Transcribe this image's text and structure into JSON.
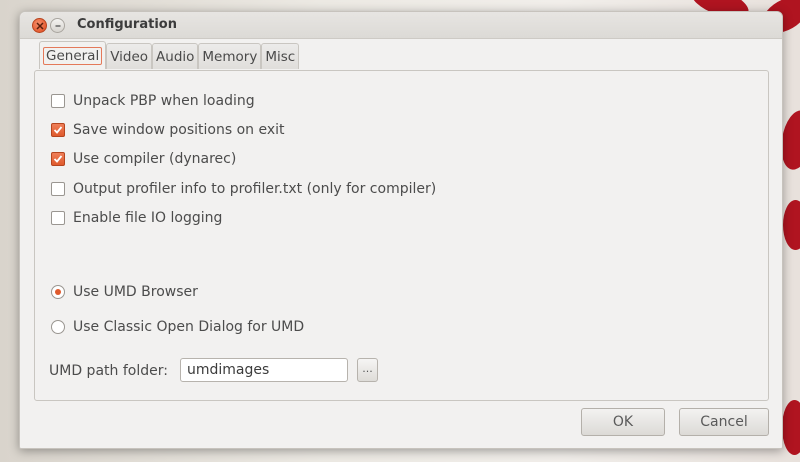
{
  "window": {
    "title": "Configuration"
  },
  "tabs": [
    {
      "label": "General"
    },
    {
      "label": "Video"
    },
    {
      "label": "Audio"
    },
    {
      "label": "Memory"
    },
    {
      "label": "Misc"
    }
  ],
  "general": {
    "checkboxes": [
      {
        "label": "Unpack PBP when loading",
        "checked": false
      },
      {
        "label": "Save window positions on exit",
        "checked": true
      },
      {
        "label": "Use compiler (dynarec)",
        "checked": true
      },
      {
        "label": "Output profiler info to profiler.txt (only for compiler)",
        "checked": false
      },
      {
        "label": "Enable file IO logging",
        "checked": false
      }
    ],
    "radios": [
      {
        "label": "Use UMD Browser",
        "selected": true
      },
      {
        "label": "Use Classic Open Dialog for UMD",
        "selected": false
      }
    ],
    "umd_path": {
      "label": "UMD path folder:",
      "value": "umdimages",
      "browse_label": "..."
    }
  },
  "buttons": {
    "ok": "OK",
    "cancel": "Cancel"
  },
  "colors": {
    "accent": "#df5a2d",
    "dialog_bg": "#f2f1f0"
  }
}
